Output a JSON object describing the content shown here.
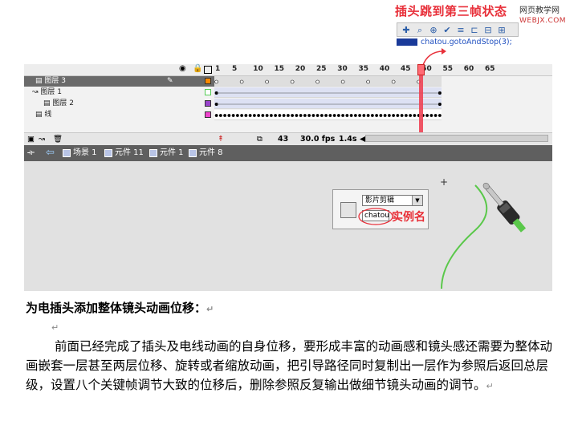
{
  "annotation": {
    "title": "插头跳到第三帧状态",
    "instance_name_label": "实例名"
  },
  "watermark": {
    "line1": "网页教学网",
    "line2": "WEBJX.COM"
  },
  "actions": {
    "code": "chatou.gotoAndStop(3);"
  },
  "timeline": {
    "frame_ticks": [
      "1",
      "5",
      "10",
      "15",
      "20",
      "25",
      "30",
      "35",
      "40",
      "45",
      "50",
      "55",
      "60",
      "65"
    ],
    "layers": [
      {
        "name": "图层 3",
        "selected": true,
        "color": "#ff8800"
      },
      {
        "name": "图层 1",
        "selected": false,
        "color": "#55cc55"
      },
      {
        "name": "图层 2",
        "selected": false,
        "color": "#9944cc"
      },
      {
        "name": "线",
        "selected": false,
        "color": "#ee44cc"
      }
    ],
    "status": {
      "frame": "43",
      "fps": "30.0 fps",
      "time": "1.4s"
    }
  },
  "breadcrumbs": [
    "场景 1",
    "元件 11",
    "元件 1",
    "元件 8"
  ],
  "properties": {
    "type_select": "影片剪辑",
    "instance_name": "chatou"
  },
  "document": {
    "heading": "为电插头添加整体镜头动画位移：",
    "paragraph": "前面已经完成了插头及电线动画的自身位移，要形成丰富的动画感和镜头感还需要为整体动画嵌套一层甚至两层位移、旋转或者缩放动画，把引导路径同时复制出一层作为参照后返回总层级，设置八个关键帧调节大致的位移后，删除参照反复输出做细节镜头动画的调节。"
  },
  "colors": {
    "accent_red": "#e8303a",
    "wire_green": "#5ac84a"
  }
}
